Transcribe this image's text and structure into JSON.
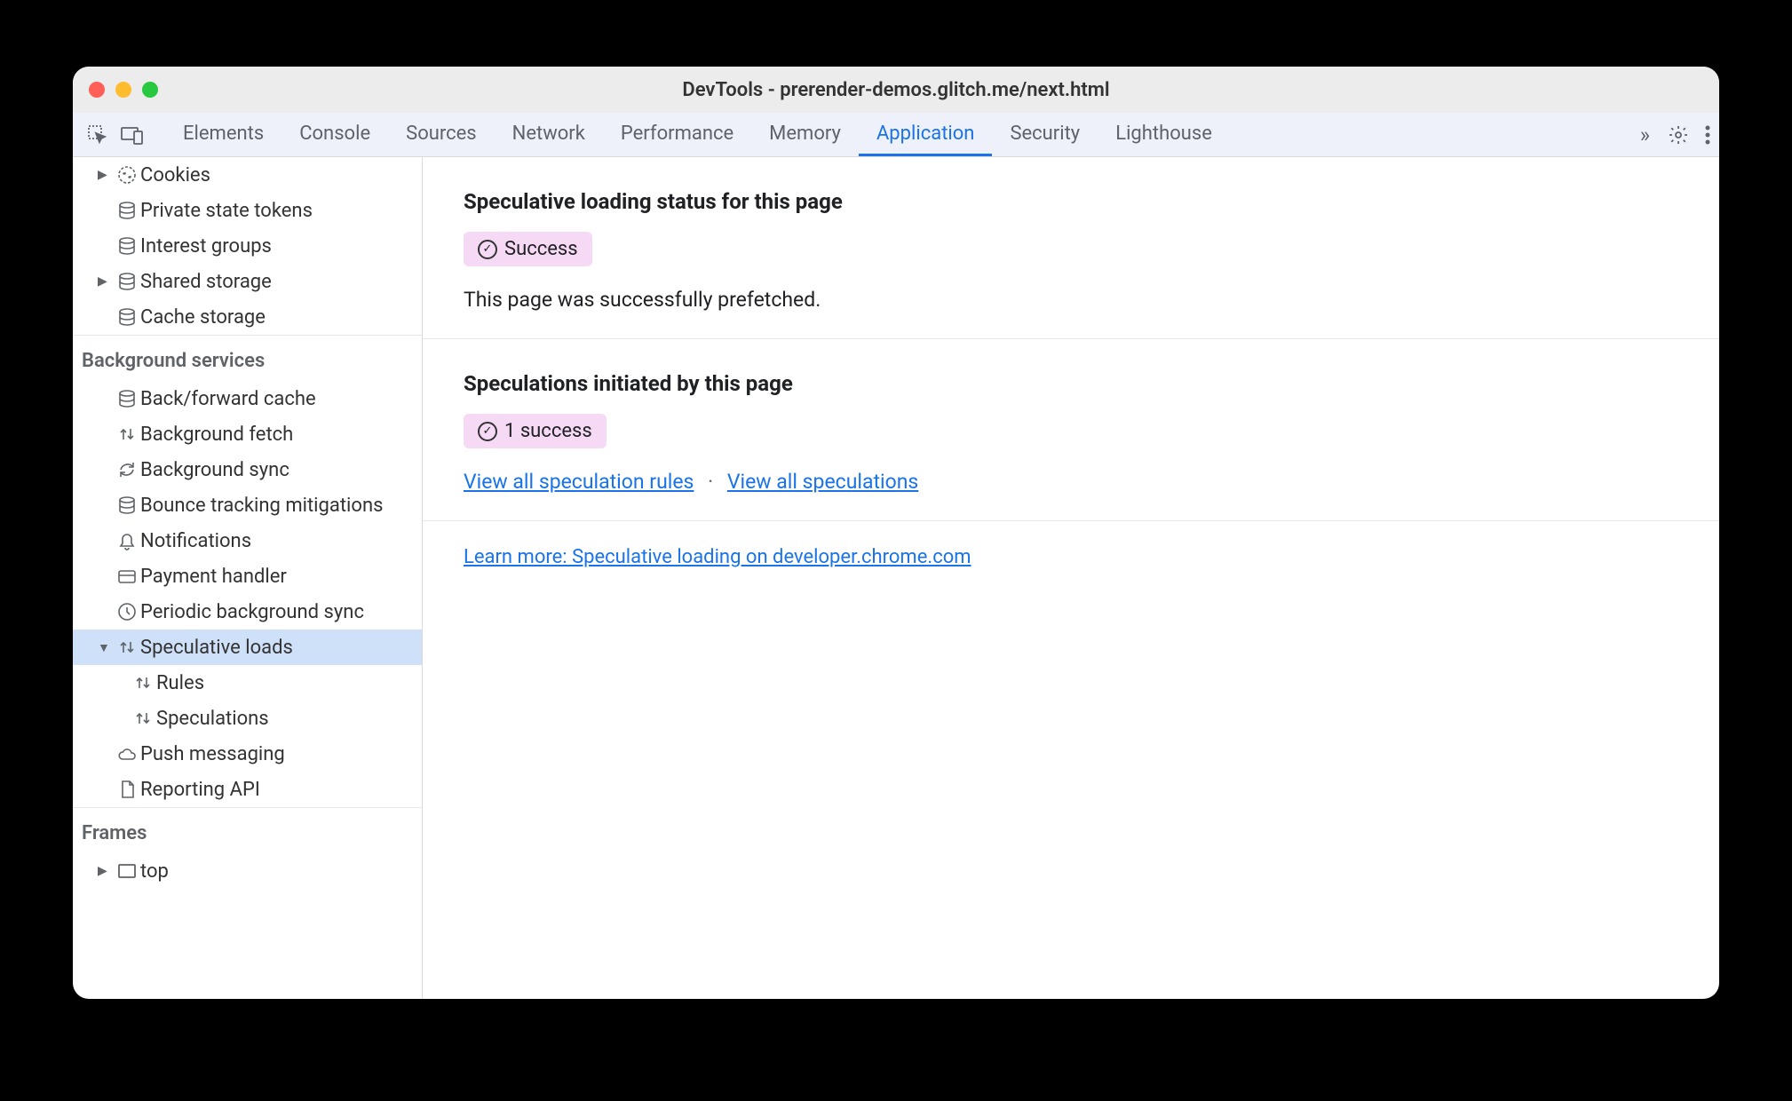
{
  "window_title": "DevTools - prerender-demos.glitch.me/next.html",
  "tabs": [
    "Elements",
    "Console",
    "Sources",
    "Network",
    "Performance",
    "Memory",
    "Application",
    "Security",
    "Lighthouse"
  ],
  "active_tab": "Application",
  "sidebar": {
    "storage_items": [
      {
        "label": "Cookies",
        "icon": "cookie",
        "arrow": "right",
        "indent": 0
      },
      {
        "label": "Private state tokens",
        "icon": "db",
        "arrow": "",
        "indent": 0
      },
      {
        "label": "Interest groups",
        "icon": "db",
        "arrow": "",
        "indent": 0
      },
      {
        "label": "Shared storage",
        "icon": "db",
        "arrow": "right",
        "indent": 0
      },
      {
        "label": "Cache storage",
        "icon": "db",
        "arrow": "",
        "indent": 0
      }
    ],
    "bg_header": "Background services",
    "bg_items": [
      {
        "label": "Back/forward cache",
        "icon": "db",
        "arrow": "",
        "indent": 0
      },
      {
        "label": "Background fetch",
        "icon": "updown",
        "arrow": "",
        "indent": 0
      },
      {
        "label": "Background sync",
        "icon": "sync",
        "arrow": "",
        "indent": 0
      },
      {
        "label": "Bounce tracking mitigations",
        "icon": "db",
        "arrow": "",
        "indent": 0
      },
      {
        "label": "Notifications",
        "icon": "bell",
        "arrow": "",
        "indent": 0
      },
      {
        "label": "Payment handler",
        "icon": "card",
        "arrow": "",
        "indent": 0
      },
      {
        "label": "Periodic background sync",
        "icon": "clock",
        "arrow": "",
        "indent": 0
      },
      {
        "label": "Speculative loads",
        "icon": "updown",
        "arrow": "down",
        "indent": 0,
        "selected": true
      },
      {
        "label": "Rules",
        "icon": "updown",
        "arrow": "",
        "indent": 1
      },
      {
        "label": "Speculations",
        "icon": "updown",
        "arrow": "",
        "indent": 1
      },
      {
        "label": "Push messaging",
        "icon": "cloud",
        "arrow": "",
        "indent": 0
      },
      {
        "label": "Reporting API",
        "icon": "doc",
        "arrow": "",
        "indent": 0
      }
    ],
    "frames_header": "Frames",
    "frames_items": [
      {
        "label": "top",
        "icon": "frame",
        "arrow": "right",
        "indent": 0
      }
    ]
  },
  "main": {
    "section1": {
      "heading": "Speculative loading status for this page",
      "badge": "Success",
      "desc": "This page was successfully prefetched."
    },
    "section2": {
      "heading": "Speculations initiated by this page",
      "badge": "1 success",
      "link1": "View all speculation rules",
      "link2": "View all speculations"
    },
    "learn_more": "Learn more: Speculative loading on developer.chrome.com"
  }
}
